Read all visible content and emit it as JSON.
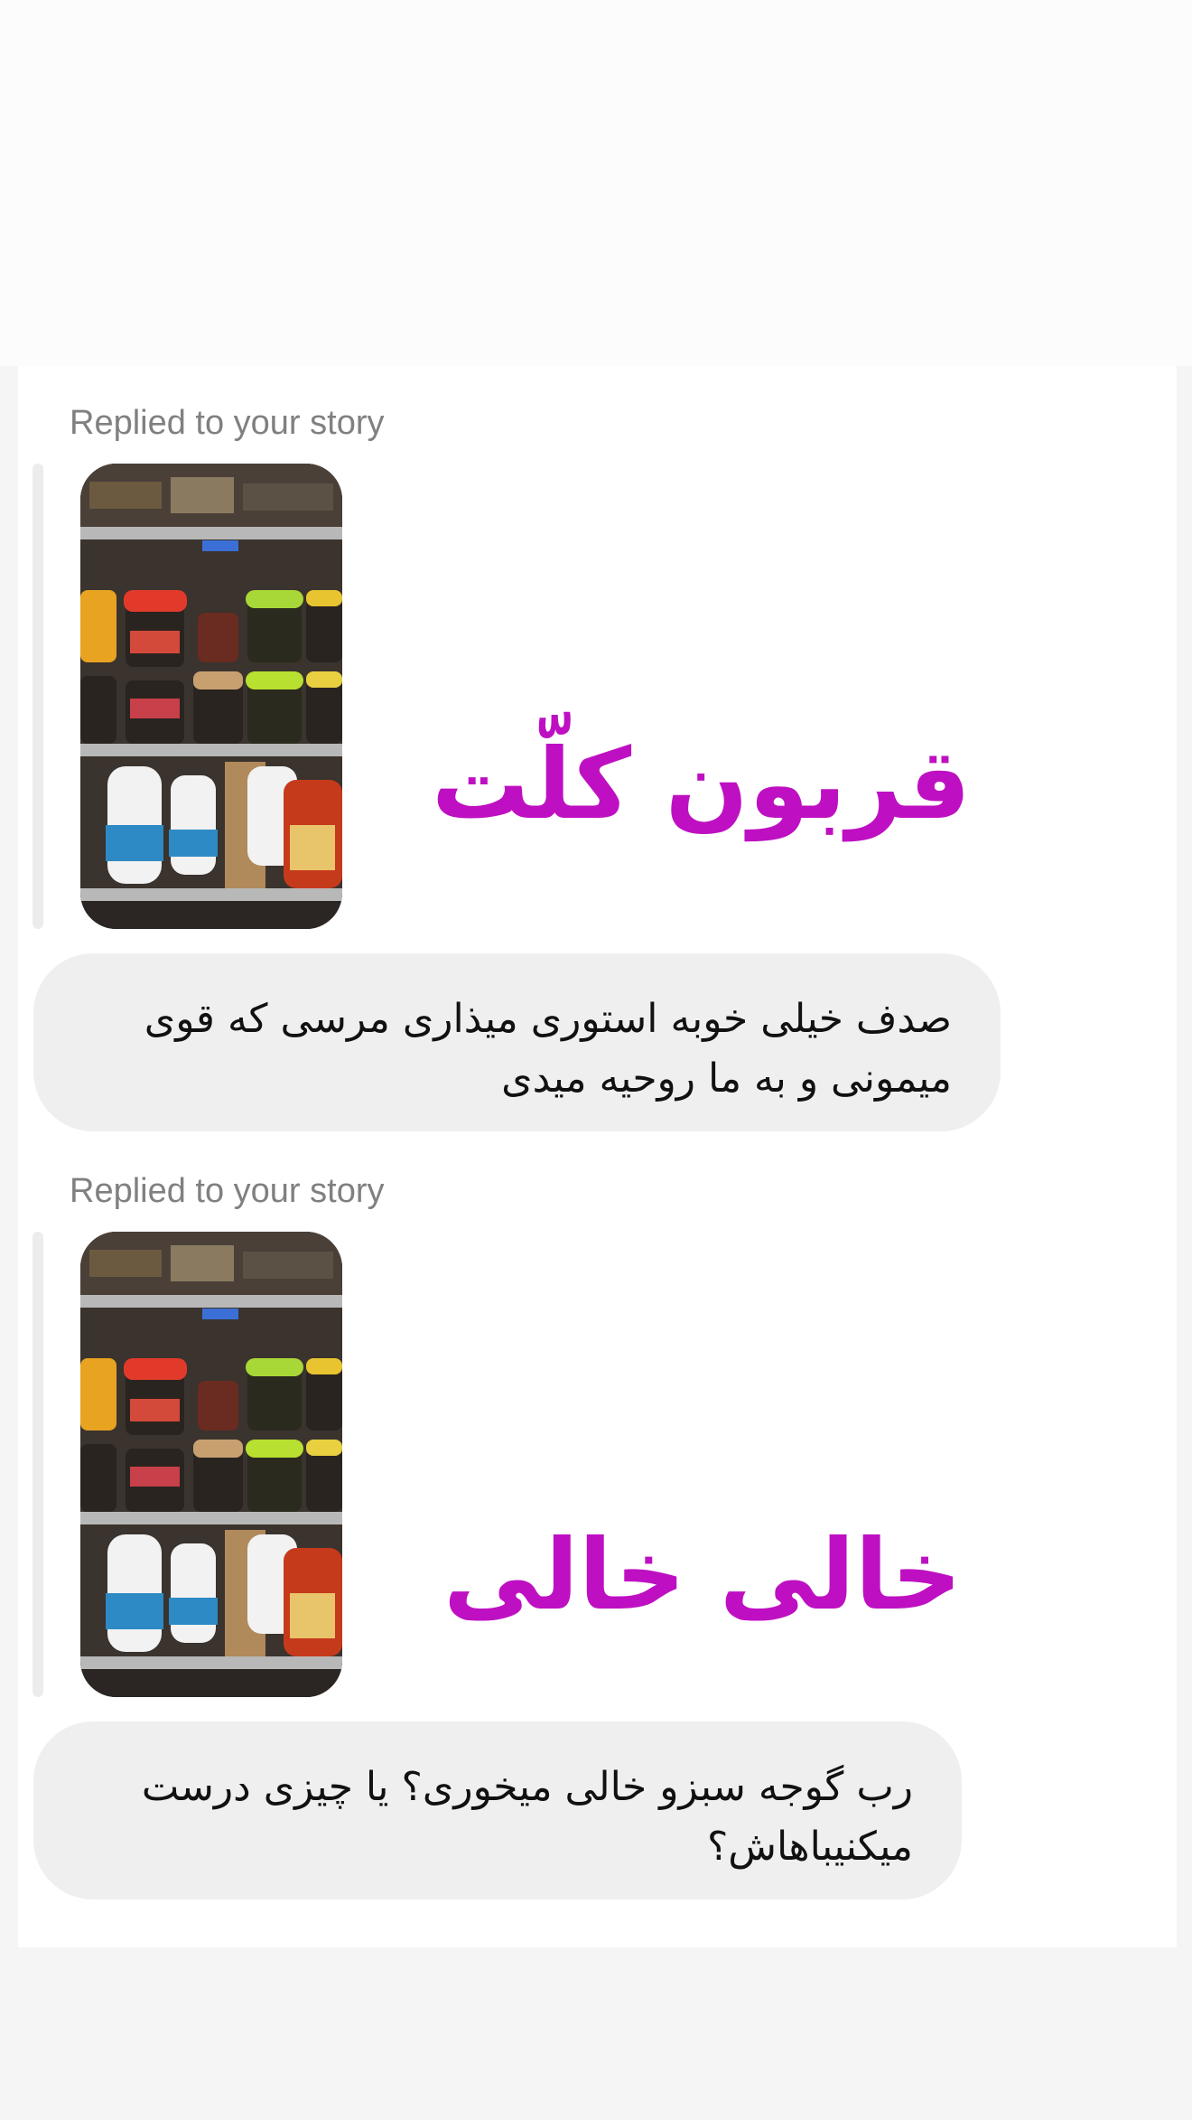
{
  "thread": {
    "messages": [
      {
        "reply_label": "Replied to your story",
        "story_caption": "قربون کلّت",
        "text": "صدف خیلی خوبه استوری میذاری مرسی که قوی میمونی و به ما روحیه میدی"
      },
      {
        "reply_label": "Replied to your story",
        "story_caption": "خالی خالی",
        "text": "رب گوجه سبزو خالی میخوری؟ یا چیزی درست میکنیباهاش؟"
      }
    ]
  },
  "colors": {
    "caption": "#be10c2",
    "bubble": "#efefef",
    "label": "#808080"
  },
  "icons": {
    "story_thumbnail": "pantry-shelf-photo"
  }
}
